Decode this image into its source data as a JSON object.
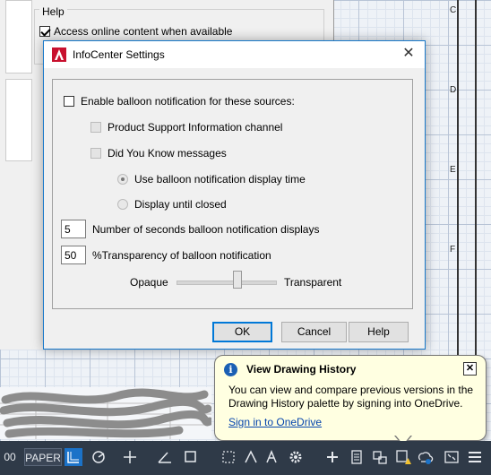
{
  "background_dialog": {
    "group_label": "Help",
    "access_online_label": "Access online content when available",
    "access_online_checked": true
  },
  "drawing": {
    "ruler_letters": [
      "C",
      "D",
      "E",
      "F"
    ]
  },
  "dialog": {
    "title": "InfoCenter Settings",
    "enable_balloon_label": "Enable balloon notification for these sources:",
    "enable_balloon_checked": false,
    "product_support_label": "Product Support Information channel",
    "did_you_know_label": "Did You Know messages",
    "use_balloon_time_label": "Use balloon notification display time",
    "display_until_closed_label": "Display until closed",
    "seconds_value": "5",
    "seconds_label": "Number of seconds balloon notification displays",
    "transparency_value": "50",
    "transparency_label": "%Transparency of balloon notification",
    "opaque_label": "Opaque",
    "transparent_label": "Transparent",
    "transparency_slider_fraction": 0.5,
    "ok_label": "OK",
    "cancel_label": "Cancel",
    "help_label": "Help"
  },
  "balloon": {
    "title": "View Drawing History",
    "body": "You can view and compare previous versions in the Drawing History palette by signing into OneDrive.",
    "link": "Sign in to OneDrive"
  },
  "statusbar": {
    "zoom_fragment": "00",
    "paper_label": "PAPER"
  },
  "colors": {
    "accent": "#0078d7",
    "statusbar_bg": "#2f3a48",
    "active_tool": "#1b72c8",
    "balloon_bg": "#ffffe1"
  }
}
